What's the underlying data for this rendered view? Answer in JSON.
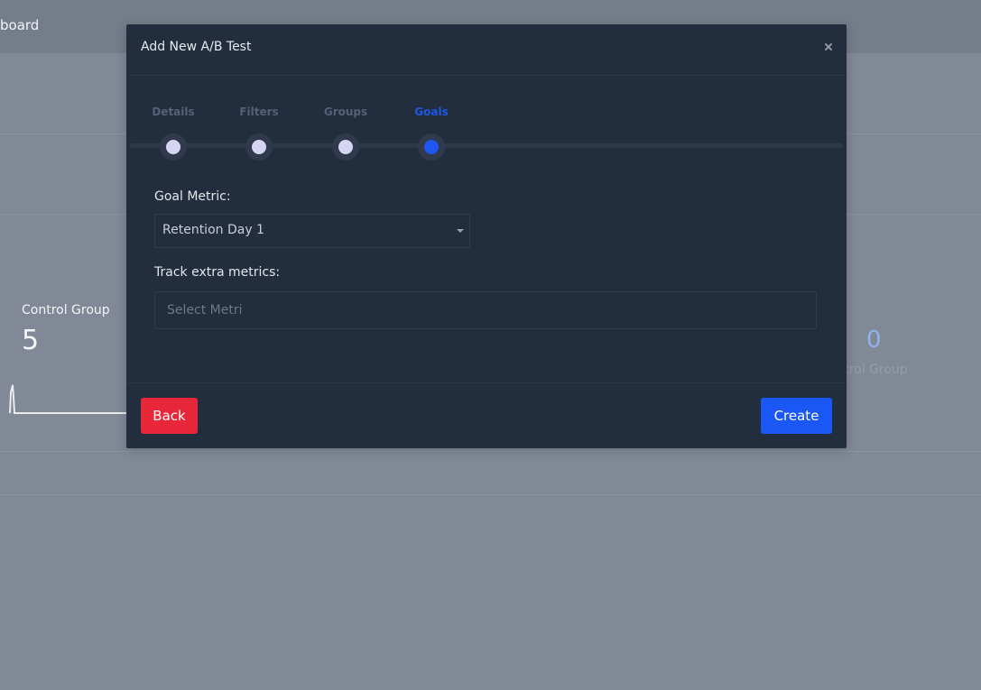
{
  "background": {
    "breadcrumb": "board",
    "left_card": {
      "title": "Control Group",
      "value": "5"
    },
    "right_card": {
      "value": "0",
      "label": "Control Group"
    }
  },
  "modal": {
    "title": "Add New A/B Test",
    "close_icon": "close-icon",
    "steps": [
      {
        "label": "Details",
        "state": "completed"
      },
      {
        "label": "Filters",
        "state": "completed"
      },
      {
        "label": "Groups",
        "state": "completed"
      },
      {
        "label": "Goals",
        "state": "active"
      }
    ],
    "goal_metric": {
      "label": "Goal Metric:",
      "value": "Retention Day 1"
    },
    "extra_metrics": {
      "label": "Track extra metrics:",
      "placeholder": "Select Metri"
    },
    "back_label": "Back",
    "create_label": "Create"
  },
  "colors": {
    "modal_bg": "#222d3e",
    "active_step": "#1f55f0",
    "back_button": "#e8283a",
    "create_button": "#1a57f5"
  }
}
